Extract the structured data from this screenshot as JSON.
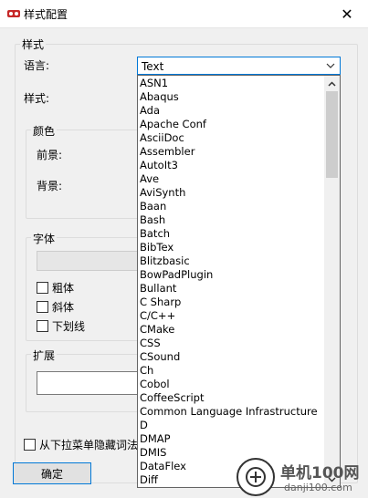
{
  "window": {
    "title": "样式配置",
    "close": "✕"
  },
  "style_group": {
    "title": "样式",
    "language_label": "语言:",
    "style_label": "样式:",
    "language_value": "Text"
  },
  "color_group": {
    "title": "颜色",
    "foreground_label": "前景:",
    "background_label": "背景:"
  },
  "font_group": {
    "title": "字体",
    "bold": "粗体",
    "italic": "斜体",
    "underline": "下划线"
  },
  "extension_group": {
    "title": "扩展"
  },
  "hide_checkbox_label": "从下拉菜单隐藏词法",
  "ok_button": "确定",
  "dropdown_items": [
    "ASN1",
    "Abaqus",
    "Ada",
    "Apache Conf",
    "AsciiDoc",
    "Assembler",
    "AutoIt3",
    "Ave",
    "AviSynth",
    "Baan",
    "Bash",
    "Batch",
    "BibTex",
    "Blitzbasic",
    "BowPadPlugin",
    "Bullant",
    "C Sharp",
    "C/C++",
    "CMake",
    "CSS",
    "CSound",
    "Ch",
    "Cobol",
    "CoffeeScript",
    "Common Language Infrastructure",
    "D",
    "DMAP",
    "DMIS",
    "DataFlex",
    "Diff"
  ],
  "watermark": {
    "text1": "单机100网",
    "text2": "danji100.com"
  },
  "colors": {
    "accent": "#0078d7",
    "window_bg": "#f0f0f0"
  }
}
